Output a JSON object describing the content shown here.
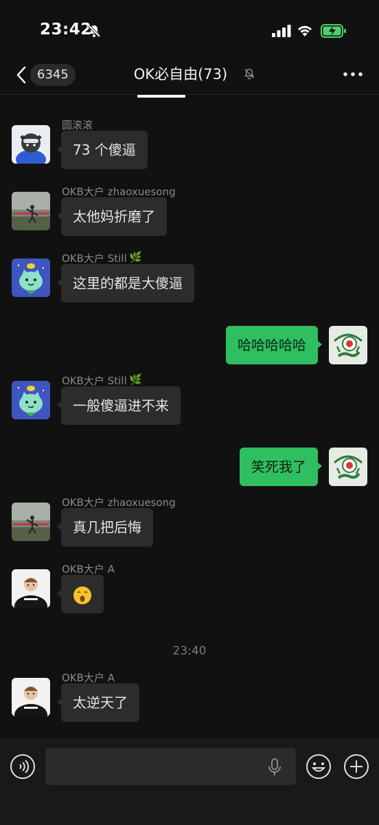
{
  "status_bar": {
    "time": "23:42"
  },
  "header": {
    "back_count": "6345",
    "title": "OK必自由(73)"
  },
  "messages": [
    {
      "sender": "圆滚滚",
      "text": "73 个傻逼"
    },
    {
      "sender": "OKB大户 zhaoxuesong",
      "text": "太他妈折磨了"
    },
    {
      "sender": "OKB大户 Still",
      "text": "这里的都是大傻逼"
    },
    {
      "text": "哈哈哈哈哈"
    },
    {
      "sender": "OKB大户 Still",
      "text": "一般傻逼进不来"
    },
    {
      "text": "笑死我了"
    },
    {
      "sender": "OKB大户 zhaoxuesong",
      "text": "真几把后悔"
    },
    {
      "sender": "OKB大户 A",
      "text": "😯"
    },
    {
      "sender": "OKB大户 A",
      "text": "太逆天了"
    }
  ],
  "divider_time": "23:40",
  "input": {
    "placeholder": ""
  },
  "colors": {
    "background": "#111111",
    "outgoing_bubble": "#2fbf60",
    "incoming_bubble": "#2c2c2c"
  },
  "icons": [
    "mute-icon",
    "signal-icon",
    "wifi-icon",
    "battery-charging-icon",
    "back-chevron-icon",
    "more-dots-icon",
    "voice-icon",
    "microphone-icon",
    "emoji-icon",
    "plus-icon"
  ]
}
